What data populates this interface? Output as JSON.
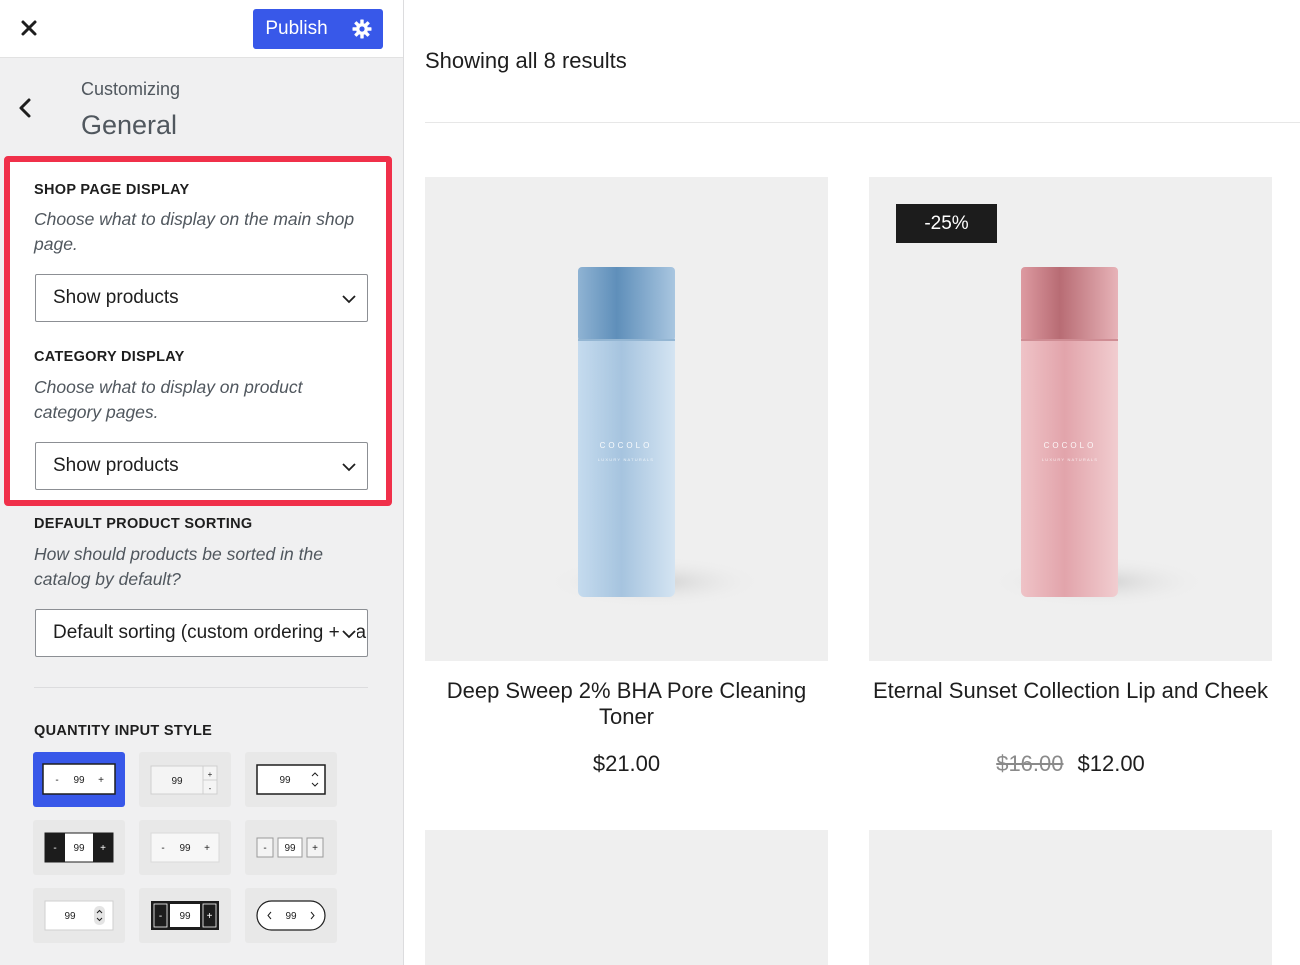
{
  "header": {
    "close_icon": "close-icon",
    "publish_label": "Publish",
    "settings_icon": "gear-icon",
    "accent": "#3858e9"
  },
  "panel": {
    "back_icon": "chevron-left-icon",
    "breadcrumb": "Customizing",
    "title": "General"
  },
  "controls": {
    "shop_page_display": {
      "label": "SHOP PAGE DISPLAY",
      "description": "Choose what to display on the main shop page.",
      "value": "Show products"
    },
    "category_display": {
      "label": "CATEGORY DISPLAY",
      "description": "Choose what to display on product category pages.",
      "value": "Show products"
    },
    "default_sorting": {
      "label": "DEFAULT PRODUCT SORTING",
      "description": "How should products be sorted in the catalog by default?",
      "value": "Default sorting (custom ordering + name)"
    },
    "quantity_style": {
      "label": "QUANTITY INPUT STYLE",
      "selected_index": 0,
      "sample_value": "99",
      "styles": [
        "minus-plus-outlined",
        "stacked-plus-minus",
        "stepper-arrows",
        "dark-minus-plus",
        "plain-minus-plus",
        "boxed-minus-plus",
        "spinner-arrows",
        "dark-boxed-minus-plus",
        "rounded-chevrons"
      ]
    },
    "highlight_color": "#f0304a"
  },
  "shop": {
    "results_text": "Showing all 8 results",
    "products": [
      {
        "title": "Deep Sweep 2% BHA Pore Cleaning Toner",
        "price": "$21.00",
        "old_price": "",
        "badge": "",
        "bottle_color": "#a9c6e0",
        "brand": "COCOLO",
        "brand_sub": "LUXURY NATURALS"
      },
      {
        "title": "Eternal Sunset Collection Lip and Cheek",
        "price": "$12.00",
        "old_price": "$16.00",
        "badge": "-25%",
        "bottle_color": "#e3aab0",
        "brand": "COCOLO",
        "brand_sub": "LUXURY NATURALS"
      }
    ]
  }
}
